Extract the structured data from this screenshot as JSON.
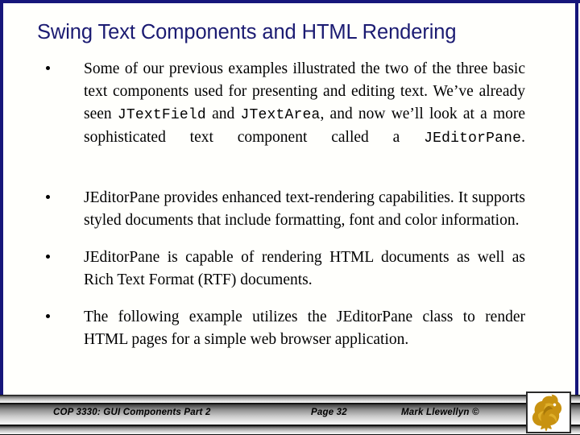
{
  "slide": {
    "title": "Swing Text Components and HTML Rendering",
    "accent_navy": "#16167a",
    "title_color": "#1b1b72",
    "background": "#fffffd",
    "body_text_color": "#000000"
  },
  "bullets": [
    {
      "marker": "bullet-dot",
      "segments": [
        {
          "kind": "text",
          "value": "Some of our previous examples illustrated the two of the three basic text components used for presenting and editing text.  We’ve already seen "
        },
        {
          "kind": "code",
          "value": "JTextField"
        },
        {
          "kind": "text",
          "value": " and "
        },
        {
          "kind": "code",
          "value": "JTextArea"
        },
        {
          "kind": "text",
          "value": ", and now we’ll look at a more sophisticated text component called a "
        },
        {
          "kind": "code",
          "value": "JEditorPane"
        },
        {
          "kind": "text",
          "value": "."
        }
      ]
    },
    {
      "marker": "bullet-dot",
      "segments": [
        {
          "kind": "text",
          "value": "JEditorPane provides enhanced text-rendering capabilities.  It supports styled documents that include formatting, font and color information."
        }
      ]
    },
    {
      "marker": "bullet-dot",
      "segments": [
        {
          "kind": "text",
          "value": "JEditorPane is capable of rendering HTML documents as well as Rich Text Format (RTF) documents."
        }
      ]
    },
    {
      "marker": "bullet-dot",
      "segments": [
        {
          "kind": "text",
          "value": "The following example utilizes the JEditorPane class to render HTML pages for a simple web browser application."
        }
      ]
    }
  ],
  "footer": {
    "course": "COP 3330: GUI Components Part 2",
    "page": "Page 32",
    "author": "Mark Llewellyn ©",
    "bar_color_dark": "#3d3d3d",
    "bar_color_light": "#f8f8f8"
  },
  "logo": {
    "name": "ucf-pegasus-logo",
    "color": "#c89211",
    "highlight": "#e0b02a"
  }
}
